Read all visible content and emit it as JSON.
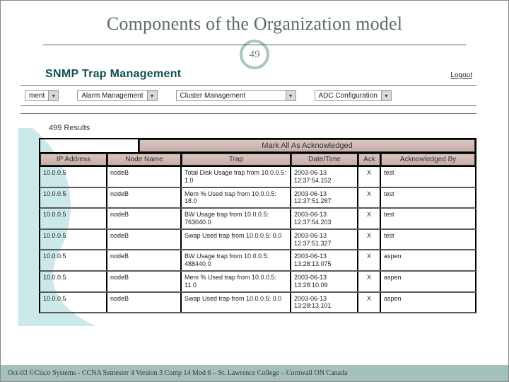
{
  "slide": {
    "title": "Components of the Organization model",
    "badge": "49",
    "footer": "Oct-03 ©Cisco Systems - CCNA Semester 4 Version 3 Comp 14 Mod 6 – St. Lawrence College – Cornwall ON Canada"
  },
  "app": {
    "title": "SNMP Trap Management",
    "logout": "Logout",
    "nav": [
      {
        "label": "ment"
      },
      {
        "label": "Alarm Management"
      },
      {
        "label": "Cluster Management"
      },
      {
        "label": "ADC Configuration"
      }
    ],
    "results": "499 Results",
    "mark_all_btn": "Mark All As Acknowledged",
    "columns": {
      "ip": "IP Address",
      "node": "Node Name",
      "trap": "Trap",
      "dt": "Date/Time",
      "ack": "Ack",
      "ackby": "Acknowledged By"
    },
    "rows": [
      {
        "ip": "10.0.0.5",
        "node": "nodeB",
        "trap": "Total Disk Usage trap from 10.0.0.5: 1.0",
        "dt": "2003-06-13 12:37:54.152",
        "ack": "X",
        "ackby": "test"
      },
      {
        "ip": "10.0.0.5",
        "node": "nodeB",
        "trap": "Mem % Used trap from 10.0.0.5: 18.0",
        "dt": "2003-06-13 12:37:51.287",
        "ack": "X",
        "ackby": "test"
      },
      {
        "ip": "10.0.0.5",
        "node": "nodeB",
        "trap": "BW Usage trap from 10.0.0.5: 763040.0",
        "dt": "2003-06-13 12:37:54.203",
        "ack": "X",
        "ackby": "test"
      },
      {
        "ip": "10.0.0.5",
        "node": "nodeB",
        "trap": "Swap Used trap from 10.0.0.5: 0.0",
        "dt": "2003-06-13 12:37:51.327",
        "ack": "X",
        "ackby": "test"
      },
      {
        "ip": "10.0.0.5",
        "node": "nodeB",
        "trap": "BW Usage trap from 10.0.0.5: 488440.0",
        "dt": "2003-06-13 13:28:13.075",
        "ack": "X",
        "ackby": "aspen"
      },
      {
        "ip": "10.0.0.5",
        "node": "nodeB",
        "trap": "Mem % Used trap from 10.0.0.5: 11.0",
        "dt": "2003-06-13 13:28:10.09",
        "ack": "X",
        "ackby": "aspen"
      },
      {
        "ip": "10.0.0.5",
        "node": "nodeB",
        "trap": "Swap Used trap from 10.0.0.5: 0.0",
        "dt": "2003-06-13 13:28:13.101",
        "ack": "X",
        "ackby": "aspen"
      }
    ]
  }
}
